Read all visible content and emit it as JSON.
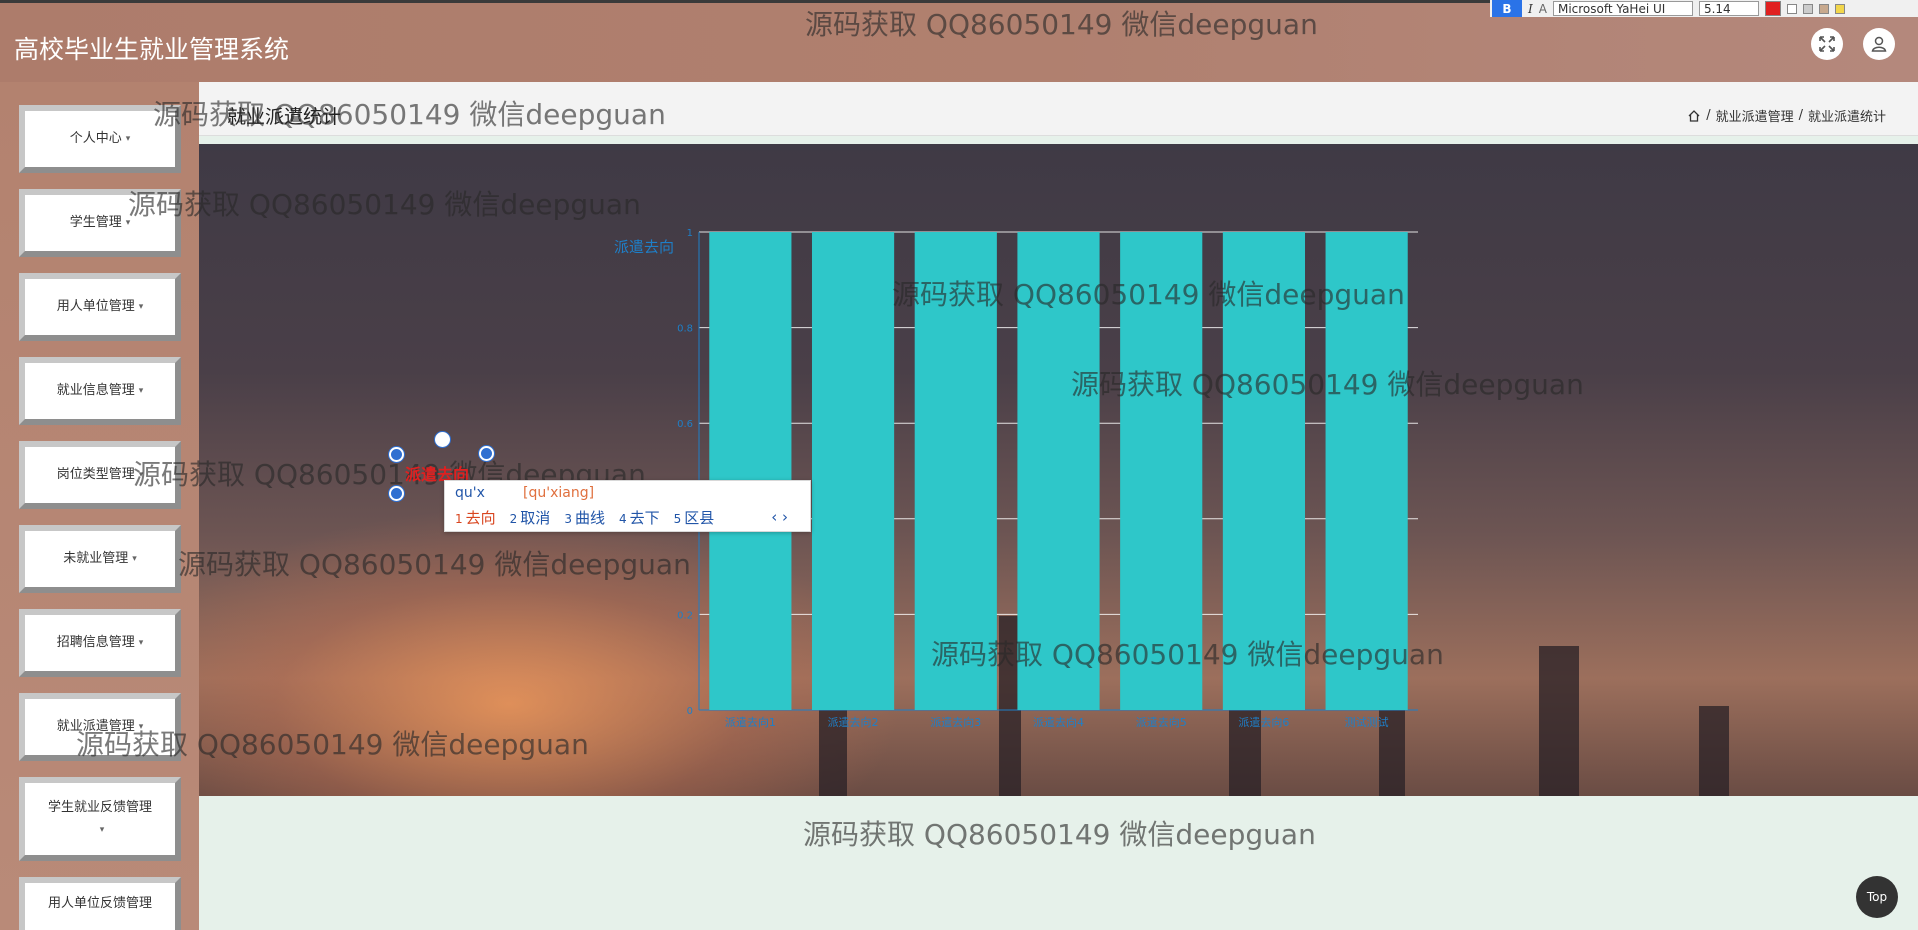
{
  "app": {
    "title": "高校毕业生就业管理系统"
  },
  "toolbar": {
    "bold": "B",
    "italic": "I",
    "font_name": "Microsoft YaHei UI",
    "font_size": "5.14"
  },
  "sidebar": {
    "items": [
      {
        "label": "个人中心"
      },
      {
        "label": "学生管理"
      },
      {
        "label": "用人单位管理"
      },
      {
        "label": "就业信息管理"
      },
      {
        "label": "岗位类型管理"
      },
      {
        "label": "未就业管理"
      },
      {
        "label": "招聘信息管理"
      },
      {
        "label": "就业派遣管理"
      },
      {
        "label": "学生就业反馈管理"
      },
      {
        "label": "用人单位反馈管理"
      }
    ]
  },
  "page": {
    "title": "就业派遣统计",
    "breadcrumb": [
      "就业派遣管理",
      "就业派遣统计"
    ]
  },
  "chart_data": {
    "type": "bar",
    "title": "派遣去向",
    "categories": [
      "派遣去向1",
      "派遣去向2",
      "派遣去向3",
      "派遣去向4",
      "派遣去向5",
      "派遣去向6",
      "测试测试"
    ],
    "values": [
      1,
      1,
      1,
      1,
      1,
      1,
      1
    ],
    "ylim": [
      0,
      1
    ],
    "yticks": [
      "0",
      "0.2",
      "0.4",
      "0.6",
      "0.8",
      "1"
    ],
    "grid": true,
    "color": "#2ec7c9"
  },
  "ime": {
    "composition": "qu'x",
    "pinyin": "[qu'xiang]",
    "candidates": [
      {
        "num": "1",
        "text": "去向"
      },
      {
        "num": "2",
        "text": "取消"
      },
      {
        "num": "3",
        "text": "曲线"
      },
      {
        "num": "4",
        "text": "去下"
      },
      {
        "num": "5",
        "text": "区县"
      }
    ],
    "nav": "‹ ›"
  },
  "edit_text": "派遣去向",
  "watermark": "源码获取 QQ86050149 微信deepguan",
  "top_button": "Top"
}
